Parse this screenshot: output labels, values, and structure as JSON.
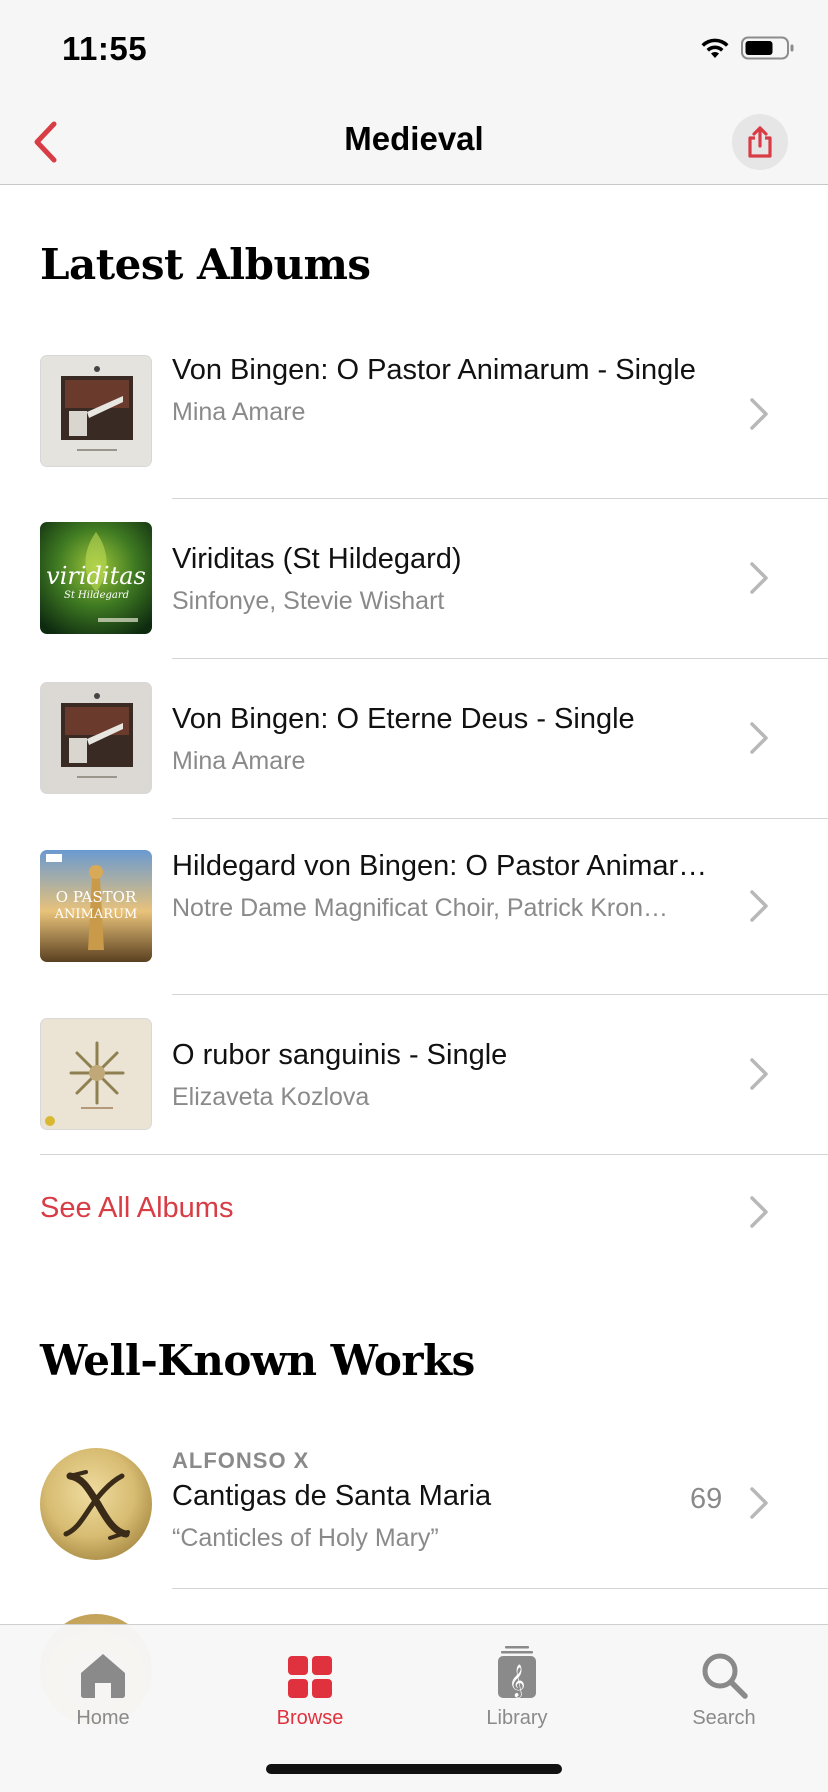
{
  "status_bar": {
    "time": "11:55"
  },
  "nav": {
    "title": "Medieval"
  },
  "latest": {
    "heading": "Latest Albums",
    "albums": [
      {
        "title": "Von Bingen: O Pastor Animarum - Single",
        "artist": "Mina Amare"
      },
      {
        "title": "Viriditas (St Hildegard)",
        "artist": "Sinfonye, Stevie Wishart",
        "art_text": "viriditas",
        "art_subtext": "St Hildegard"
      },
      {
        "title": "Von Bingen: O Eterne Deus - Single",
        "artist": "Mina Amare"
      },
      {
        "title": "Hildegard von Bingen: O Pastor Animarum (arr. for choir by David Mar…",
        "artist": "Notre Dame Magnificat Choir, Patrick Kron…",
        "art_text_1": "O PASTOR",
        "art_text_2": "ANIMARUM"
      },
      {
        "title": "O rubor sanguinis - Single",
        "artist": "Elizaveta Kozlova"
      }
    ],
    "see_all": "See All Albums"
  },
  "works": {
    "heading": "Well-Known Works",
    "items": [
      {
        "composer": "ALFONSO X",
        "title": "Cantigas de Santa Maria",
        "subtitle": "“Canticles of Holy Mary”",
        "count": "69"
      }
    ]
  },
  "tabs": [
    {
      "label": "Home",
      "icon": "house-icon",
      "active": false
    },
    {
      "label": "Browse",
      "icon": "grid-icon",
      "active": true
    },
    {
      "label": "Library",
      "icon": "music-library-icon",
      "active": false
    },
    {
      "label": "Search",
      "icon": "magnifier-icon",
      "active": false
    }
  ],
  "colors": {
    "accent": "#d83c45",
    "secondary_text": "#8a8a8a",
    "bar_bg": "#f6f6f6"
  }
}
